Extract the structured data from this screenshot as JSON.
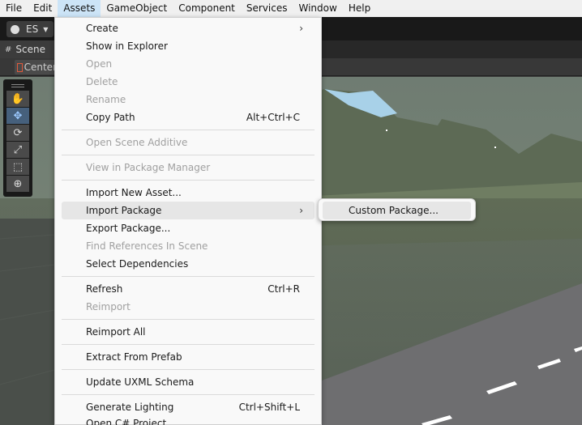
{
  "menubar": {
    "items": [
      "File",
      "Edit",
      "Assets",
      "GameObject",
      "Component",
      "Services",
      "Window",
      "Help"
    ],
    "active": "Assets"
  },
  "toolbar": {
    "account_label": "ES"
  },
  "scene": {
    "tab_label": "Scene",
    "center_label": "Center"
  },
  "tools": [
    "hand-tool",
    "move-tool",
    "rotate-tool",
    "scale-tool",
    "rect-tool",
    "transform-tool"
  ],
  "assets_menu": {
    "items": [
      {
        "label": "Create",
        "submenu": true
      },
      {
        "label": "Show in Explorer"
      },
      {
        "label": "Open",
        "disabled": true
      },
      {
        "label": "Delete",
        "disabled": true
      },
      {
        "label": "Rename",
        "disabled": true
      },
      {
        "label": "Copy Path",
        "shortcut": "Alt+Ctrl+C"
      },
      {
        "label": "Open Scene Additive",
        "disabled": true
      },
      {
        "label": "View in Package Manager",
        "disabled": true
      },
      {
        "label": "Import New Asset..."
      },
      {
        "label": "Import Package",
        "submenu": true,
        "highlighted": true
      },
      {
        "label": "Export Package..."
      },
      {
        "label": "Find References In Scene",
        "disabled": true
      },
      {
        "label": "Select Dependencies"
      },
      {
        "label": "Refresh",
        "shortcut": "Ctrl+R"
      },
      {
        "label": "Reimport",
        "disabled": true
      },
      {
        "label": "Reimport All"
      },
      {
        "label": "Extract From Prefab"
      },
      {
        "label": "Update UXML Schema"
      },
      {
        "label": "Generate Lighting",
        "shortcut": "Ctrl+Shift+L"
      },
      {
        "label": "Open C# Project"
      }
    ]
  },
  "import_package_submenu": {
    "items": [
      {
        "label": "Custom Package...",
        "highlighted": true
      }
    ]
  },
  "colors": {
    "menu_bg": "#f9f9f9",
    "highlight": "#e6e6e6",
    "disabled_text": "#a0a0a0",
    "unity_dark": "#191919",
    "selected_tool": "#46607c"
  }
}
